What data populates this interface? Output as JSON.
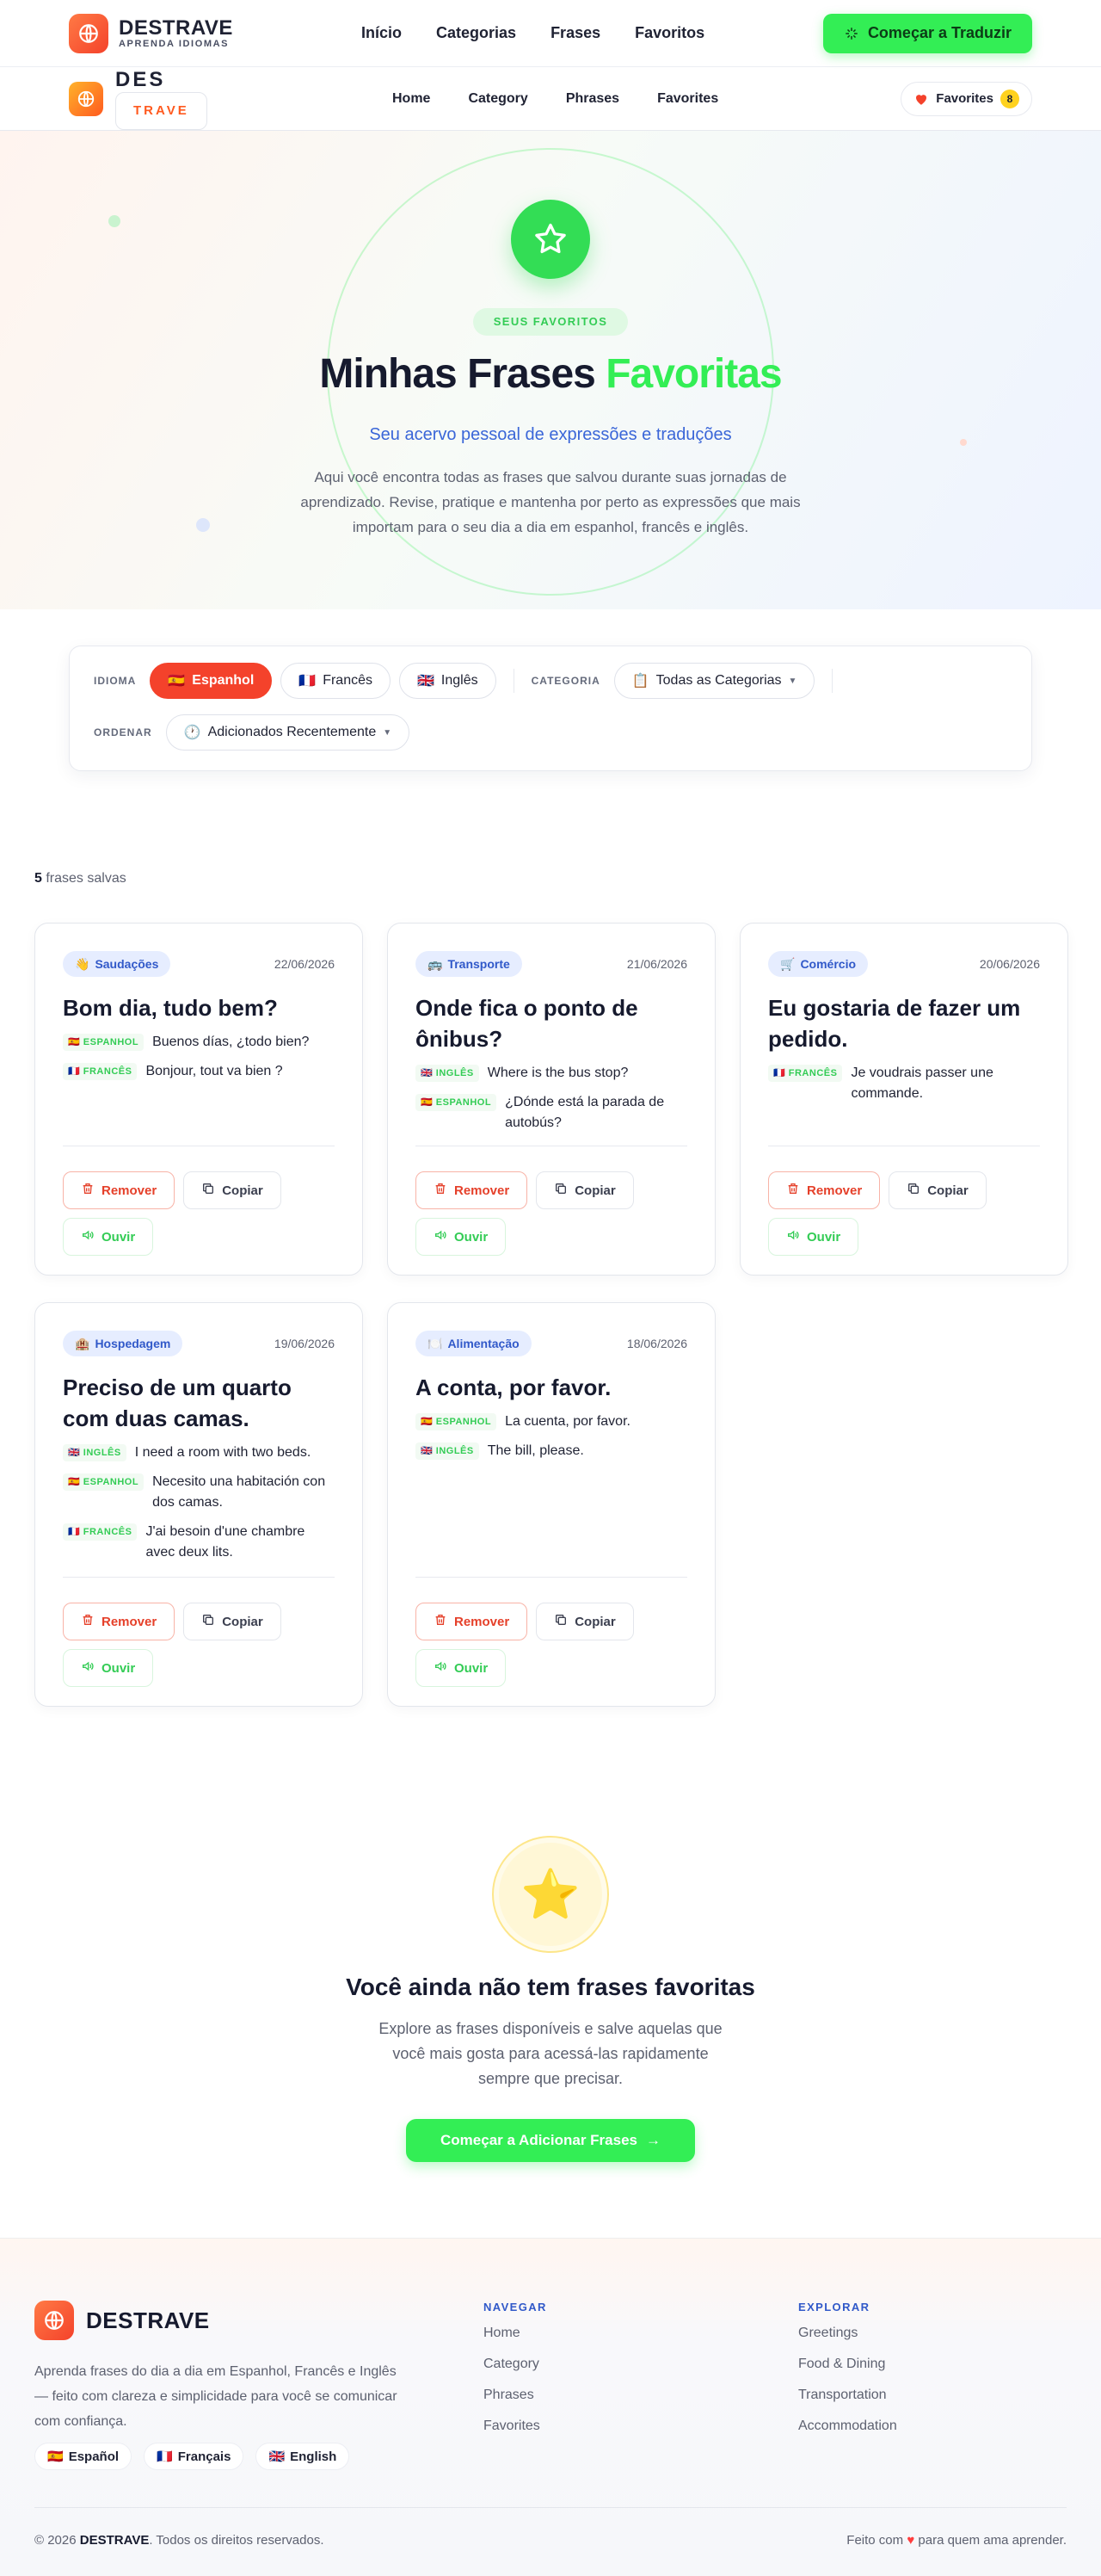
{
  "header1": {
    "brand": "DESTRAVE",
    "tagline": "APRENDA IDIOMAS",
    "nav": [
      "Início",
      "Categorias",
      "Frases",
      "Favoritos"
    ],
    "cta": "Começar a Traduzir"
  },
  "header2": {
    "brand_a": "DES",
    "brand_b": "TRAVE",
    "nav": [
      "Home",
      "Category",
      "Phrases",
      "Favorites"
    ],
    "favorites_label": "Favorites",
    "favorites_count": "8"
  },
  "hero": {
    "pill": "SEUS FAVORITOS",
    "title_a": "Minhas Frases ",
    "title_b": "Favoritas",
    "subtitle": "Seu acervo pessoal de expressões e traduções",
    "description": "Aqui você encontra todas as frases que salvou durante suas jornadas de aprendizado. Revise, pratique e mantenha por perto as expressões que mais importam para o seu dia a dia em espanhol, francês e inglês."
  },
  "filters": {
    "language_label": "IDIOMA",
    "languages": [
      {
        "flag": "🇪🇸",
        "label": "Espanhol",
        "active": true
      },
      {
        "flag": "🇫🇷",
        "label": "Francês"
      },
      {
        "flag": "🇬🇧",
        "label": "Inglês"
      }
    ],
    "category_label": "CATEGORIA",
    "category_icon": "📋",
    "category_value": "Todas as Categorias",
    "sort_label": "ORDENAR",
    "sort_icon": "🕐",
    "sort_value": "Adicionados Recentemente"
  },
  "count": {
    "number": "5",
    "text": "frases salvas"
  },
  "card_buttons": {
    "remove": "Remover",
    "copy": "Copiar",
    "listen": "Ouvir"
  },
  "cards": [
    {
      "icon": "👋",
      "category": "Saudações",
      "date": "22/06/2026",
      "title": "Bom dia, tudo bem?",
      "translations": [
        {
          "flag": "🇪🇸",
          "lang": "ESPANHOL",
          "text": "Buenos días, ¿todo bien?"
        },
        {
          "flag": "🇫🇷",
          "lang": "FRANCÊS",
          "text": "Bonjour, tout va bien ?"
        }
      ]
    },
    {
      "icon": "🚌",
      "category": "Transporte",
      "date": "21/06/2026",
      "title": "Onde fica o ponto de ônibus?",
      "translations": [
        {
          "flag": "🇬🇧",
          "lang": "INGLÊS",
          "text": "Where is the bus stop?"
        },
        {
          "flag": "🇪🇸",
          "lang": "ESPANHOL",
          "text": "¿Dónde está la parada de autobús?"
        }
      ]
    },
    {
      "icon": "🛒",
      "category": "Comércio",
      "date": "20/06/2026",
      "title": "Eu gostaria de fazer um pedido.",
      "translations": [
        {
          "flag": "🇫🇷",
          "lang": "FRANCÊS",
          "text": "Je voudrais passer une commande."
        }
      ]
    },
    {
      "icon": "🏨",
      "category": "Hospedagem",
      "date": "19/06/2026",
      "title": "Preciso de um quarto com duas camas.",
      "translations": [
        {
          "flag": "🇬🇧",
          "lang": "INGLÊS",
          "text": "I need a room with two beds."
        },
        {
          "flag": "🇪🇸",
          "lang": "ESPANHOL",
          "text": "Necesito una habitación con dos camas."
        },
        {
          "flag": "🇫🇷",
          "lang": "FRANCÊS",
          "text": "J'ai besoin d'une chambre avec deux lits."
        }
      ]
    },
    {
      "icon": "🍽️",
      "category": "Alimentação",
      "date": "18/06/2026",
      "title": "A conta, por favor.",
      "translations": [
        {
          "flag": "🇪🇸",
          "lang": "ESPANHOL",
          "text": "La cuenta, por favor."
        },
        {
          "flag": "🇬🇧",
          "lang": "INGLÊS",
          "text": "The bill, please."
        }
      ]
    }
  ],
  "empty": {
    "icon": "⭐",
    "title": "Você ainda não tem frases favoritas",
    "description": "Explore as frases disponíveis e salve aquelas que você mais gosta para acessá-las rapidamente sempre que precisar.",
    "button": "Começar a Adicionar Frases",
    "arrow": "→"
  },
  "footer": {
    "brand": "DESTRAVE",
    "description": "Aprenda frases do dia a dia em Espanhol, Francês e Inglês — feito com clareza e simplicidade para você se comunicar com confiança.",
    "languages": [
      {
        "flag": "🇪🇸",
        "label": "Español"
      },
      {
        "flag": "🇫🇷",
        "label": "Français"
      },
      {
        "flag": "🇬🇧",
        "label": "English"
      }
    ],
    "nav_title": "NAVEGAR",
    "nav": [
      "Home",
      "Category",
      "Phrases",
      "Favorites"
    ],
    "explore_title": "EXPLORAR",
    "explore": [
      "Greetings",
      "Food & Dining",
      "Transportation",
      "Accommodation"
    ],
    "copyright_a": "© 2026 ",
    "copyright_brand": "DESTRAVE",
    "copyright_b": ". Todos os direitos reservados.",
    "made_a": "Feito com ",
    "made_heart": "♥",
    "made_b": " para quem ama aprender."
  },
  "colors": {
    "brand_orange": "#f4422b",
    "accent_green": "#33ee55",
    "blue": "#3159c9"
  }
}
